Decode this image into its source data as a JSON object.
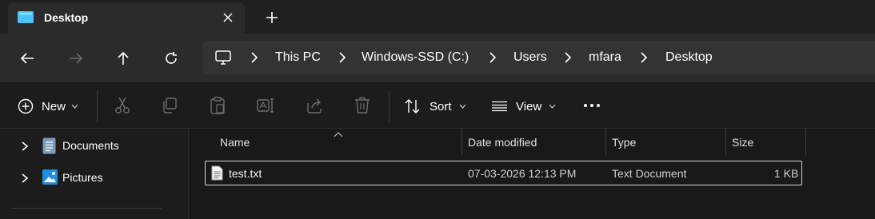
{
  "tab": {
    "title": "Desktop"
  },
  "path": [
    "This PC",
    "Windows-SSD (C:)",
    "Users",
    "mfara",
    "Desktop"
  ],
  "commands": {
    "new": "New",
    "sort": "Sort",
    "view": "View"
  },
  "nav": [
    {
      "label": "Documents",
      "icon": "documents-icon"
    },
    {
      "label": "Pictures",
      "icon": "pictures-icon"
    }
  ],
  "columns": {
    "name": "Name",
    "date": "Date modified",
    "type": "Type",
    "size": "Size"
  },
  "files": [
    {
      "name": "test.txt",
      "date": "07-03-2026 12:13 PM",
      "type": "Text Document",
      "size": "1 KB"
    }
  ],
  "colors": {
    "background": "#1c1c1c",
    "toolbar": "#2b2b2b",
    "address": "#333333",
    "accent": "#4cc2ff"
  }
}
